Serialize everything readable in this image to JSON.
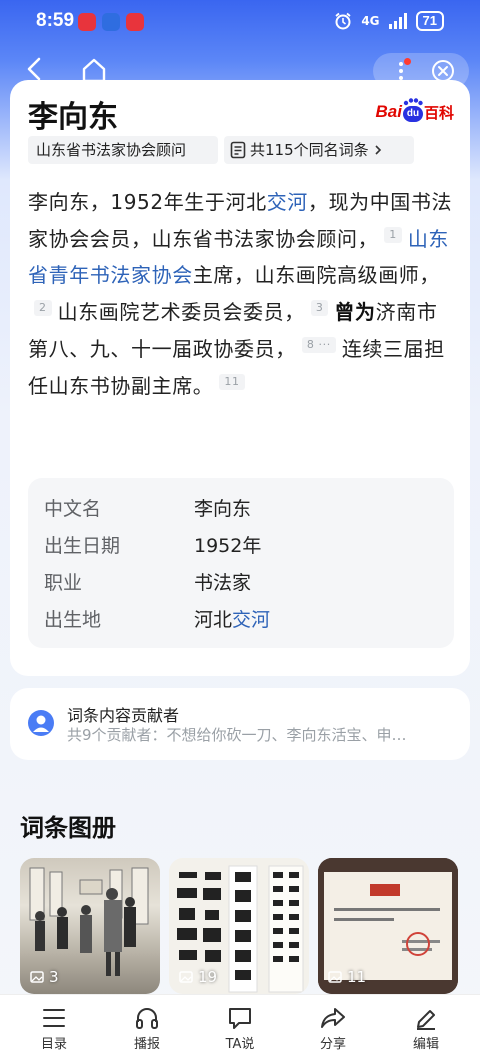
{
  "status_bar": {
    "time": "8:59",
    "network": "4G",
    "battery": "71",
    "app_icon_colors": [
      "#e8343c",
      "#2f6de0",
      "#e8343c"
    ]
  },
  "nav": {
    "back_icon": "chevron-left-icon",
    "home_icon": "home-icon",
    "menu_icon": "more-vertical-icon",
    "close_icon": "close-circle-icon"
  },
  "entry": {
    "title": "李向东",
    "logo": {
      "bai": "Bai",
      "du": "du",
      "baike": "百科"
    },
    "tag": "山东省书法家协会顾问",
    "homonym": "共115个同名词条",
    "summary": {
      "p1": "李向东，1952年生于河北",
      "link1": "交河",
      "p2": "，现为中国书法家协会会员，山东省书法家协会顾问，",
      "ref1": "1",
      "link2": "山东省青年书法家协会",
      "p3": "主席，山东画院高级画师，",
      "ref2": "2",
      "p4": "山东画院艺术委员会委员，",
      "ref3": "3",
      "bold1": "曾为",
      "p5": "济南市第八、九、十一届政协委员，",
      "ref4": "8 ···",
      "p6": "连续三届担任山东书协副主席。",
      "ref5": "11"
    },
    "info": [
      {
        "label": "中文名",
        "value": "李向东"
      },
      {
        "label": "出生日期",
        "value": "1952年"
      },
      {
        "label": "职业",
        "value": "书法家"
      },
      {
        "label": "出生地",
        "value_prefix": "河北",
        "value_link": "交河"
      }
    ]
  },
  "contributors": {
    "title": "词条内容贡献者",
    "subtitle": "共9个贡献者：不想给你砍一刀、李向东活宝、申…"
  },
  "album": {
    "title": "词条图册",
    "items": [
      {
        "count": "3"
      },
      {
        "count": "19"
      },
      {
        "count": "11"
      }
    ]
  },
  "bottom_bar": [
    {
      "label": "目录",
      "icon": "list-icon"
    },
    {
      "label": "播报",
      "icon": "headphones-icon"
    },
    {
      "label": "TA说",
      "icon": "chat-icon"
    },
    {
      "label": "分享",
      "icon": "share-icon"
    },
    {
      "label": "编辑",
      "icon": "edit-icon"
    }
  ],
  "colors": {
    "header_blue": "#3a66f0",
    "link": "#2e63b8",
    "baike_red": "#e10601",
    "baike_blue": "#2932e1"
  }
}
